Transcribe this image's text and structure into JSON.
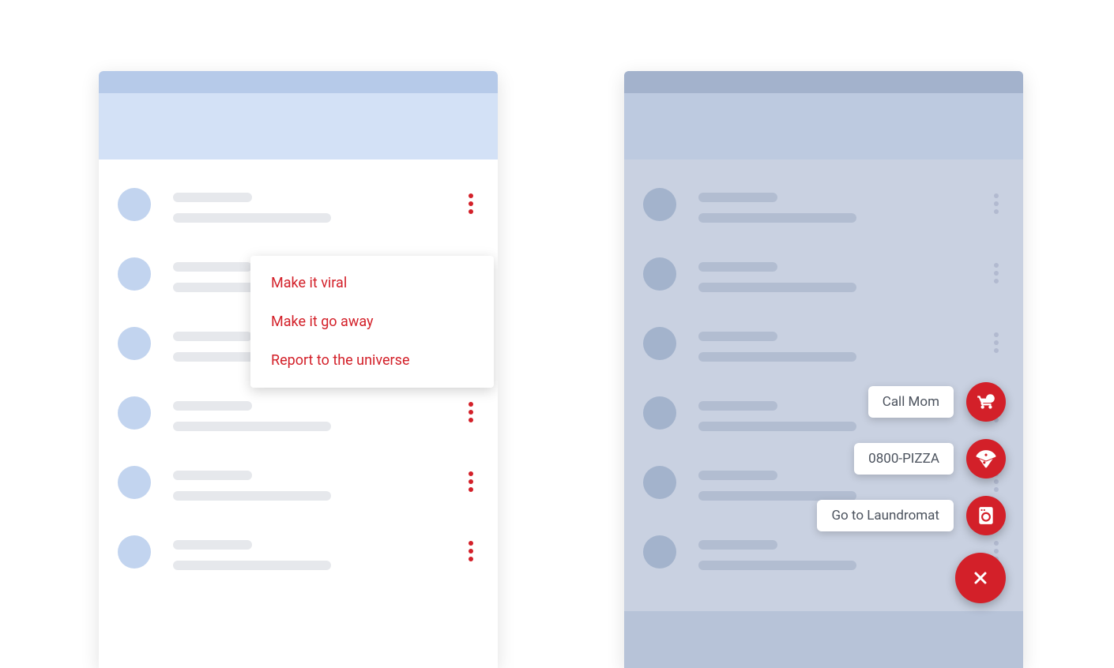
{
  "colors": {
    "accent": "#d32029",
    "leftHeader": "#d3e1f6",
    "leftStatus": "#b6cae9",
    "rightScrim": "#c9d1e1",
    "rightHeader": "#bdcae0",
    "rightStatus": "#a3b2cc",
    "skeleton": "#e6e8ec",
    "skeletonDim": "#b2bdd1"
  },
  "leftDevice": {
    "menu": {
      "items": [
        {
          "label": "Make it viral"
        },
        {
          "label": "Make it go away"
        },
        {
          "label": "Report to the universe"
        }
      ]
    },
    "kebab_visible_rows": 6
  },
  "rightDevice": {
    "rows": 6,
    "speedDial": {
      "actions": [
        {
          "label": "Call Mom",
          "icon": "stroller-icon"
        },
        {
          "label": "0800-PIZZA",
          "icon": "pizza-icon"
        },
        {
          "label": "Go to Laundromat",
          "icon": "washer-icon"
        }
      ],
      "main": {
        "icon": "close-icon"
      }
    }
  }
}
